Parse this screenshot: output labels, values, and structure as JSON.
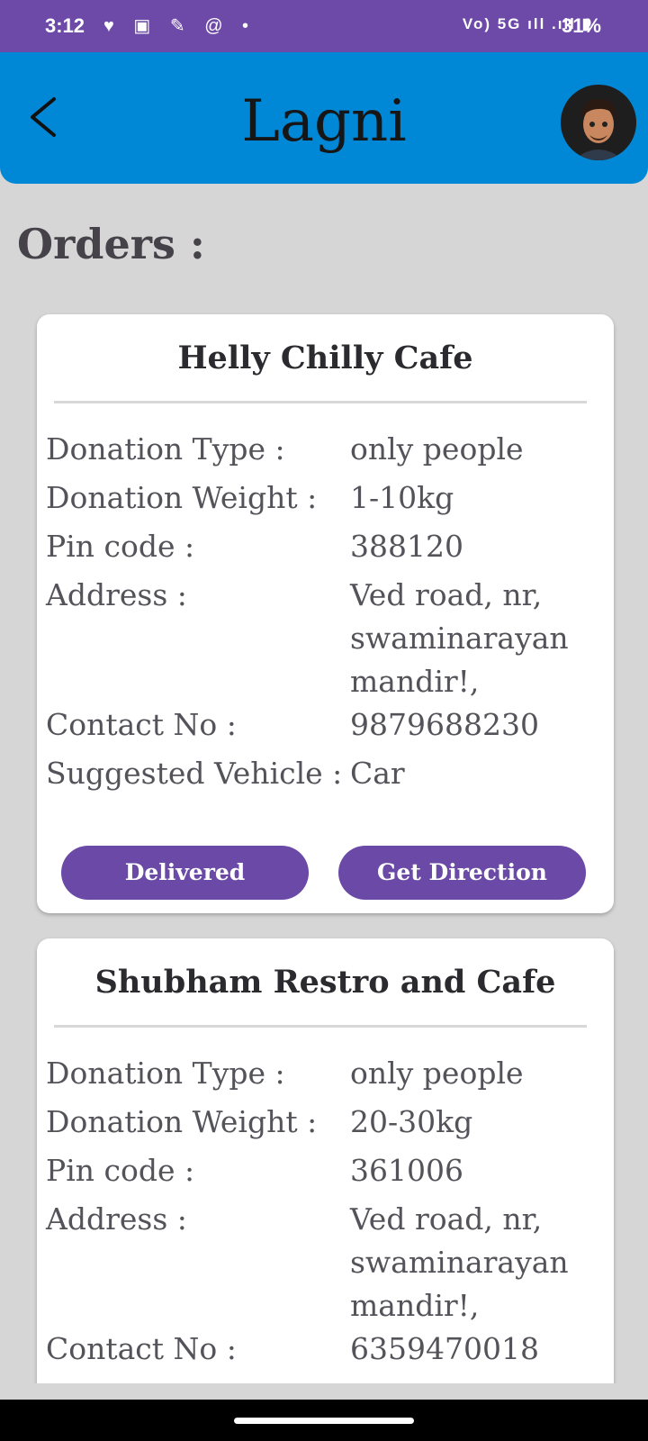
{
  "status_bar": {
    "time": "3:12",
    "left_icons": "♥ ▣ ✎ @ •",
    "right_icons": "Vo) 5G ıll .ıll ▮",
    "battery": "31%"
  },
  "app_bar": {
    "title": "Lagni",
    "back_icon": "chevron-left-icon",
    "avatar_icon": "avatar-icon",
    "color": "#0087d6"
  },
  "page": {
    "heading": "Orders :"
  },
  "orders": [
    {
      "name": "Helly Chilly Cafe",
      "donation_type_label": "Donation Type :",
      "donation_type": "only people",
      "donation_weight_label": "Donation Weight  :",
      "donation_weight": "1-10kg",
      "pin_code_label": "Pin code :",
      "pin_code": "388120",
      "address_label": "Address :",
      "address_lines": [
        "Ved road, nr,",
        "swaminarayan",
        "mandir!,"
      ],
      "contact_label": "Contact No :",
      "contact": "9879688230",
      "vehicle_label": "Suggested Vehicle :",
      "vehicle": "Car",
      "delivered_label": "Delivered",
      "direction_label": "Get Direction"
    },
    {
      "name": "Shubham Restro and Cafe",
      "donation_type_label": "Donation Type :",
      "donation_type": "only people",
      "donation_weight_label": "Donation Weight  :",
      "donation_weight": "20-30kg",
      "pin_code_label": "Pin code :",
      "pin_code": "361006",
      "address_label": "Address :",
      "address_lines": [
        "Ved road, nr,",
        "swaminarayan",
        "mandir!,"
      ],
      "contact_label": "Contact No :",
      "contact": "6359470018"
    }
  ],
  "colors": {
    "status_bar": "#6d4aa8",
    "button": "#6a4aa6",
    "background": "#d6d6d6"
  }
}
